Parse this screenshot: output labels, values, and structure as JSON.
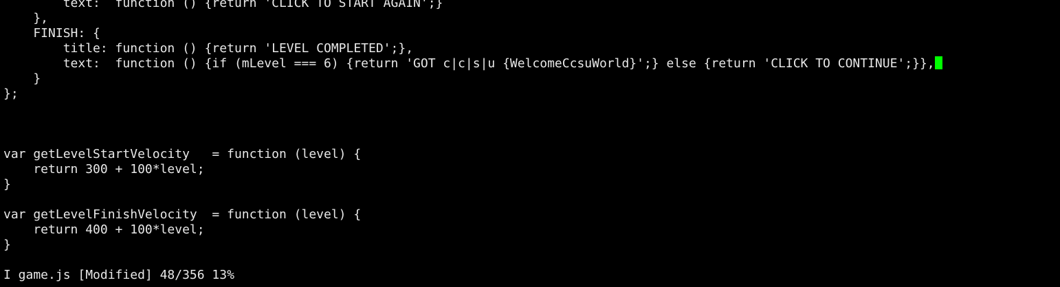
{
  "editor": {
    "lines": [
      "        text:  function () {return 'CLICK TO START AGAIN';}",
      "    },",
      "    FINISH: {",
      "        title: function () {return 'LEVEL COMPLETED';},",
      "        text:  function () {if (mLevel === 6) {return 'GOT c|c|s|u {WelcomeCcsuWorld}';} else {return 'CLICK TO CONTINUE';}},",
      "    }",
      "};",
      "",
      "",
      "",
      "var getLevelStartVelocity   = function (level) {",
      "    return 300 + 100*level;",
      "}",
      "",
      "var getLevelFinishVelocity  = function (level) {",
      "    return 400 + 100*level;",
      "}"
    ],
    "cursor_color": "#00ff00",
    "status_line": "I game.js [Modified] 48/356 13%"
  }
}
